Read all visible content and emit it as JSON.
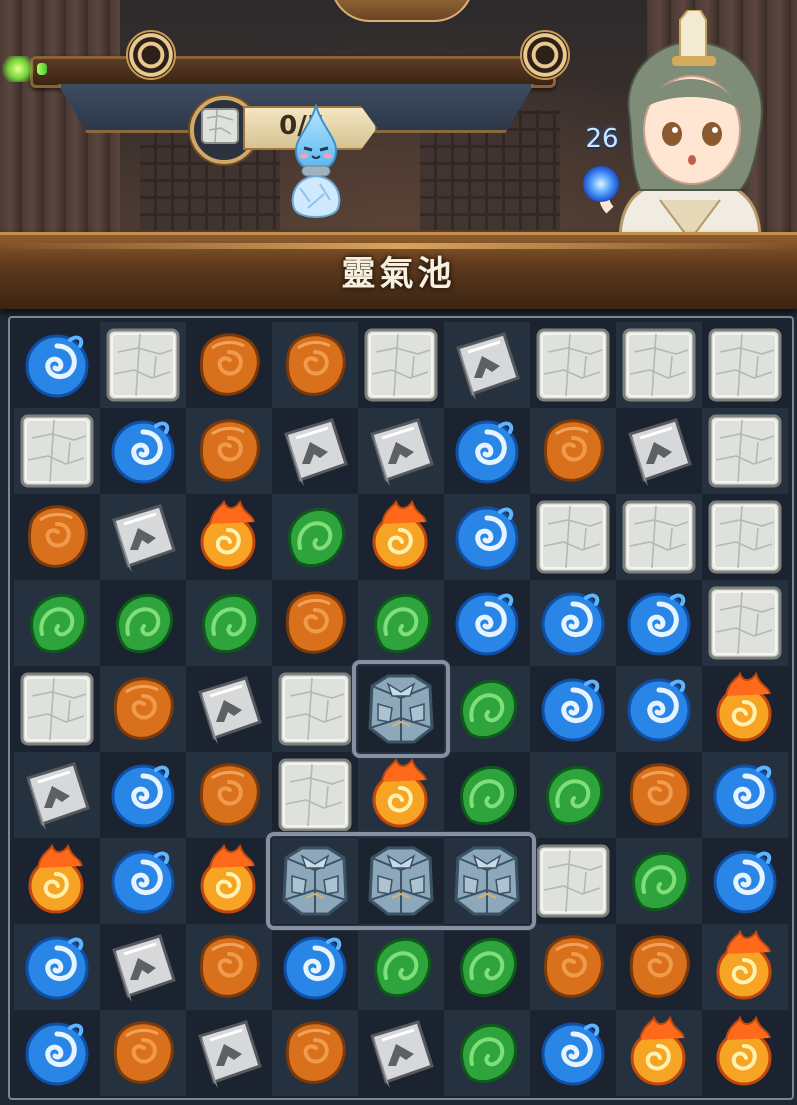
{
  "hud": {
    "goal_count": "0/5",
    "goal_item": "stone-block",
    "progress_fraction": 0.02,
    "mana_count": "26"
  },
  "board": {
    "title": "靈氣池",
    "rows": 9,
    "cols": 9,
    "grid": [
      [
        "water",
        "stone",
        "earth",
        "earth",
        "stone",
        "metal",
        "stone",
        "stone",
        "stone"
      ],
      [
        "stone",
        "water",
        "earth",
        "metal",
        "metal",
        "water",
        "earth",
        "metal",
        "stone"
      ],
      [
        "earth",
        "metal",
        "fire",
        "wood",
        "fire",
        "water",
        "stone",
        "stone",
        "stone"
      ],
      [
        "wood",
        "wood",
        "wood",
        "earth",
        "wood",
        "water",
        "water",
        "water",
        "stone"
      ],
      [
        "stone",
        "earth",
        "metal",
        "stone",
        "ice-armor",
        "wood",
        "water",
        "water",
        "fire"
      ],
      [
        "metal",
        "water",
        "earth",
        "stone",
        "fire",
        "wood",
        "wood",
        "earth",
        "water"
      ],
      [
        "fire",
        "water",
        "fire",
        "ice-armor",
        "ice-armor",
        "ice-armor",
        "stone",
        "wood",
        "water"
      ],
      [
        "water",
        "metal",
        "earth",
        "water",
        "wood",
        "wood",
        "earth",
        "earth",
        "fire"
      ],
      [
        "water",
        "earth",
        "metal",
        "earth",
        "metal",
        "wood",
        "water",
        "fire",
        "fire"
      ]
    ],
    "framed_groups": [
      {
        "row": 4,
        "col_start": 4,
        "col_end": 4
      },
      {
        "row": 6,
        "col_start": 3,
        "col_end": 5
      }
    ]
  },
  "colors": {
    "water": "#2a86e6",
    "earth": "#d9701c",
    "wood": "#2fa43c",
    "fire": "#f7a323",
    "stone": "#dfe1dc",
    "metal": "#d6d8da",
    "ice": "#8aa4b8"
  }
}
